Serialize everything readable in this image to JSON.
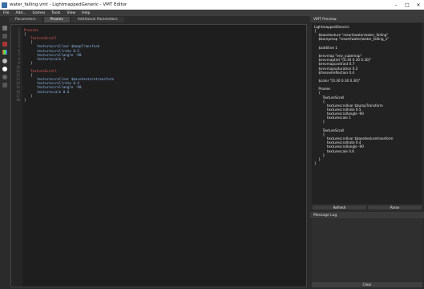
{
  "window": {
    "title": "water_falling.vmt - LightmappedGeneric - VMT Editor"
  },
  "menu": [
    "File",
    "Add...",
    "Games",
    "Tools",
    "View",
    "Help"
  ],
  "tabs": [
    {
      "label": "Parameters"
    },
    {
      "label": "Proxies"
    },
    {
      "label": "Additional Parameters"
    }
  ],
  "toolbar_icons": [
    "color-swatch-gray",
    "color-swatch-dark",
    "color-swatch-red",
    "color-swatch-multi",
    "circle-gray",
    "circle-white",
    "circle-dark",
    "list-icon"
  ],
  "editor": {
    "lines": [
      {
        "n": "1",
        "text": "Proxies",
        "cls": "kw",
        "indent": 0
      },
      {
        "n": "2",
        "text": "{",
        "cls": "br",
        "indent": 0
      },
      {
        "n": "3",
        "text": "TextureScroll",
        "cls": "kw",
        "indent": 1
      },
      {
        "n": "4",
        "text": "{",
        "cls": "br",
        "indent": 1
      },
      {
        "n": "5",
        "text": "texturescrollvar $bumpTransform",
        "cls": "pr",
        "indent": 2
      },
      {
        "n": "6",
        "text": "texturescrollrate 0.5",
        "cls": "pr",
        "indent": 2
      },
      {
        "n": "7",
        "text": "texturescrollangle -90",
        "cls": "pr",
        "indent": 2
      },
      {
        "n": "8",
        "text": "texturescale 1",
        "cls": "pr",
        "indent": 2
      },
      {
        "n": "9",
        "text": "}",
        "cls": "br",
        "indent": 1
      },
      {
        "n": "10",
        "text": "",
        "cls": "br",
        "indent": 0
      },
      {
        "n": "11",
        "text": "TextureScroll",
        "cls": "kw",
        "indent": 1
      },
      {
        "n": "12",
        "text": "{",
        "cls": "br",
        "indent": 1
      },
      {
        "n": "13",
        "text": "texturescrollvar $basetexturetransform",
        "cls": "pr",
        "indent": 2
      },
      {
        "n": "14",
        "text": "texturescrollrate 0.4",
        "cls": "pr",
        "indent": 2
      },
      {
        "n": "15",
        "text": "texturescrollangle -90",
        "cls": "pr",
        "indent": 2
      },
      {
        "n": "16",
        "text": "texturescale 0.6",
        "cls": "pr",
        "indent": 2
      },
      {
        "n": "17",
        "text": "}",
        "cls": "br",
        "indent": 1
      },
      {
        "n": "18",
        "text": "}",
        "cls": "br",
        "indent": 0
      }
    ]
  },
  "vmt_preview": {
    "header": "VMT Preview",
    "lines": [
      "LightmappedGeneric",
      "{",
      "    $basetexture \"resort/water/water_falling\"",
      "    $bumpmap \"resort/water/water_falling_n\"",
      "",
      "    $additive 1",
      "",
      "    $envmap \"env_cubemap\"",
      "    $envmaptint \"[0.30 0.30 0.30]\"",
      "    $envmapcontrast 0.7",
      "    $envmapsaturation 0.2",
      "    $fresnelreflection 0.4",
      "",
      "    $color \"[0.30 0.30 0.30]\"",
      "",
      "    Proxies",
      "    {",
      "        TextureScroll",
      "        {",
      "            texturescrollvar $bumpTransform",
      "            texturescrollrate 0.5",
      "            texturescrollangle -90",
      "            texturescale 1",
      "        }",
      "",
      "        TextureScroll",
      "        {",
      "            texturescrollvar $basetexturetransform",
      "            texturescrollrate 0.4",
      "            texturescrollangle -90",
      "            texturescale 0.6",
      "        }",
      "    }",
      "}"
    ],
    "refresh_label": "Refresh",
    "parse_label": "Parse"
  },
  "message_log": {
    "header": "Message Log",
    "clear_label": "Clear"
  },
  "colors": {
    "keyword": "#e05a5a",
    "param": "#8fb8e8",
    "background": "#1e1e1e"
  }
}
